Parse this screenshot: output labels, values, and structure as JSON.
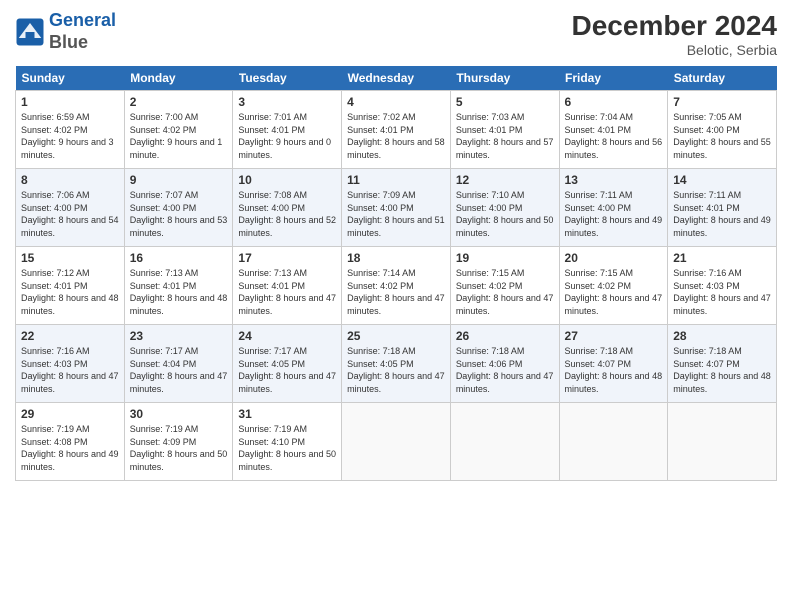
{
  "header": {
    "logo_line1": "General",
    "logo_line2": "Blue",
    "month": "December 2024",
    "location": "Belotic, Serbia"
  },
  "weekdays": [
    "Sunday",
    "Monday",
    "Tuesday",
    "Wednesday",
    "Thursday",
    "Friday",
    "Saturday"
  ],
  "weeks": [
    [
      {
        "day": "1",
        "sunrise": "6:59 AM",
        "sunset": "4:02 PM",
        "daylight": "9 hours and 3 minutes."
      },
      {
        "day": "2",
        "sunrise": "7:00 AM",
        "sunset": "4:02 PM",
        "daylight": "9 hours and 1 minute."
      },
      {
        "day": "3",
        "sunrise": "7:01 AM",
        "sunset": "4:01 PM",
        "daylight": "9 hours and 0 minutes."
      },
      {
        "day": "4",
        "sunrise": "7:02 AM",
        "sunset": "4:01 PM",
        "daylight": "8 hours and 58 minutes."
      },
      {
        "day": "5",
        "sunrise": "7:03 AM",
        "sunset": "4:01 PM",
        "daylight": "8 hours and 57 minutes."
      },
      {
        "day": "6",
        "sunrise": "7:04 AM",
        "sunset": "4:01 PM",
        "daylight": "8 hours and 56 minutes."
      },
      {
        "day": "7",
        "sunrise": "7:05 AM",
        "sunset": "4:00 PM",
        "daylight": "8 hours and 55 minutes."
      }
    ],
    [
      {
        "day": "8",
        "sunrise": "7:06 AM",
        "sunset": "4:00 PM",
        "daylight": "8 hours and 54 minutes."
      },
      {
        "day": "9",
        "sunrise": "7:07 AM",
        "sunset": "4:00 PM",
        "daylight": "8 hours and 53 minutes."
      },
      {
        "day": "10",
        "sunrise": "7:08 AM",
        "sunset": "4:00 PM",
        "daylight": "8 hours and 52 minutes."
      },
      {
        "day": "11",
        "sunrise": "7:09 AM",
        "sunset": "4:00 PM",
        "daylight": "8 hours and 51 minutes."
      },
      {
        "day": "12",
        "sunrise": "7:10 AM",
        "sunset": "4:00 PM",
        "daylight": "8 hours and 50 minutes."
      },
      {
        "day": "13",
        "sunrise": "7:11 AM",
        "sunset": "4:00 PM",
        "daylight": "8 hours and 49 minutes."
      },
      {
        "day": "14",
        "sunrise": "7:11 AM",
        "sunset": "4:01 PM",
        "daylight": "8 hours and 49 minutes."
      }
    ],
    [
      {
        "day": "15",
        "sunrise": "7:12 AM",
        "sunset": "4:01 PM",
        "daylight": "8 hours and 48 minutes."
      },
      {
        "day": "16",
        "sunrise": "7:13 AM",
        "sunset": "4:01 PM",
        "daylight": "8 hours and 48 minutes."
      },
      {
        "day": "17",
        "sunrise": "7:13 AM",
        "sunset": "4:01 PM",
        "daylight": "8 hours and 47 minutes."
      },
      {
        "day": "18",
        "sunrise": "7:14 AM",
        "sunset": "4:02 PM",
        "daylight": "8 hours and 47 minutes."
      },
      {
        "day": "19",
        "sunrise": "7:15 AM",
        "sunset": "4:02 PM",
        "daylight": "8 hours and 47 minutes."
      },
      {
        "day": "20",
        "sunrise": "7:15 AM",
        "sunset": "4:02 PM",
        "daylight": "8 hours and 47 minutes."
      },
      {
        "day": "21",
        "sunrise": "7:16 AM",
        "sunset": "4:03 PM",
        "daylight": "8 hours and 47 minutes."
      }
    ],
    [
      {
        "day": "22",
        "sunrise": "7:16 AM",
        "sunset": "4:03 PM",
        "daylight": "8 hours and 47 minutes."
      },
      {
        "day": "23",
        "sunrise": "7:17 AM",
        "sunset": "4:04 PM",
        "daylight": "8 hours and 47 minutes."
      },
      {
        "day": "24",
        "sunrise": "7:17 AM",
        "sunset": "4:05 PM",
        "daylight": "8 hours and 47 minutes."
      },
      {
        "day": "25",
        "sunrise": "7:18 AM",
        "sunset": "4:05 PM",
        "daylight": "8 hours and 47 minutes."
      },
      {
        "day": "26",
        "sunrise": "7:18 AM",
        "sunset": "4:06 PM",
        "daylight": "8 hours and 47 minutes."
      },
      {
        "day": "27",
        "sunrise": "7:18 AM",
        "sunset": "4:07 PM",
        "daylight": "8 hours and 48 minutes."
      },
      {
        "day": "28",
        "sunrise": "7:18 AM",
        "sunset": "4:07 PM",
        "daylight": "8 hours and 48 minutes."
      }
    ],
    [
      {
        "day": "29",
        "sunrise": "7:19 AM",
        "sunset": "4:08 PM",
        "daylight": "8 hours and 49 minutes."
      },
      {
        "day": "30",
        "sunrise": "7:19 AM",
        "sunset": "4:09 PM",
        "daylight": "8 hours and 50 minutes."
      },
      {
        "day": "31",
        "sunrise": "7:19 AM",
        "sunset": "4:10 PM",
        "daylight": "8 hours and 50 minutes."
      },
      null,
      null,
      null,
      null
    ]
  ]
}
